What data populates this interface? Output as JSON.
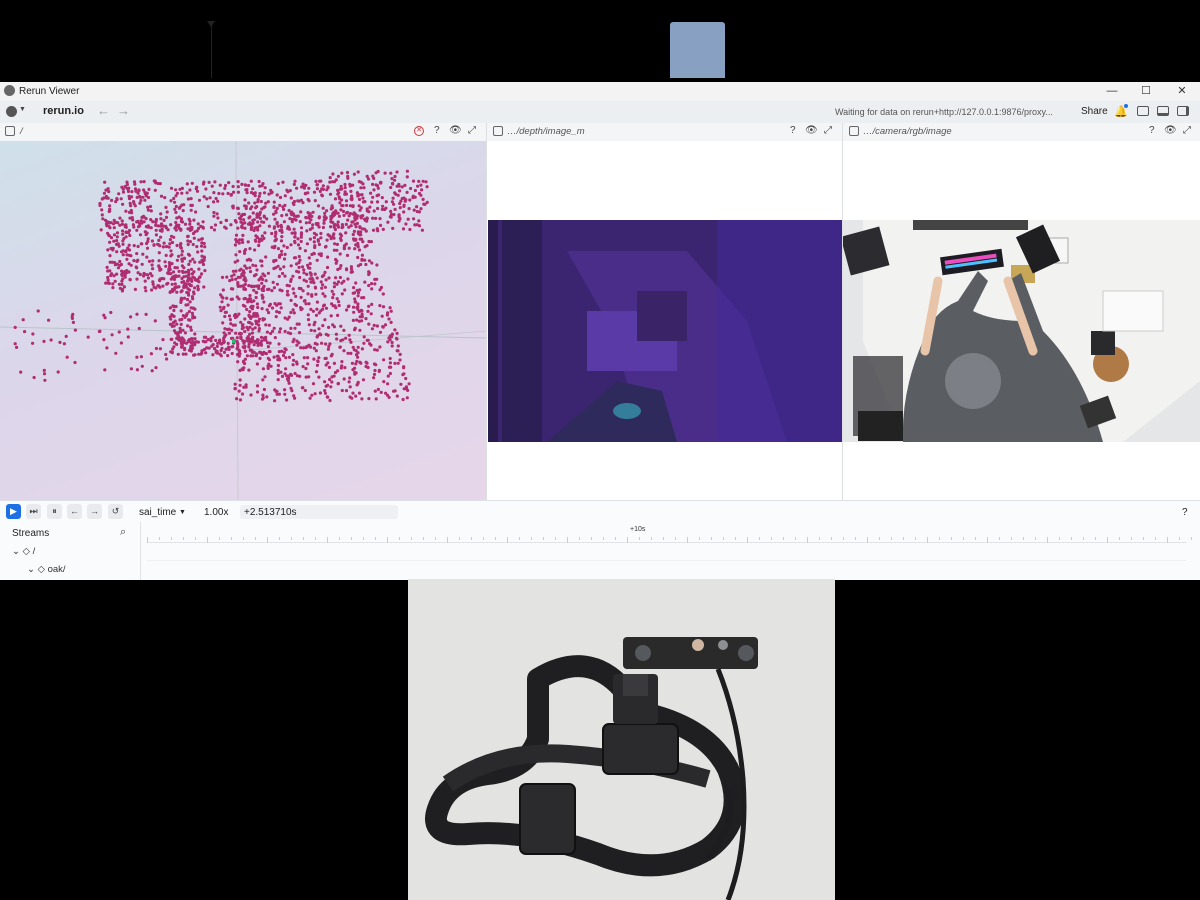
{
  "window": {
    "title": "Rerun Viewer",
    "controls": [
      "—",
      "☐",
      "✕"
    ]
  },
  "topbar": {
    "brand": "rerun.io",
    "back": "←",
    "forward": "→",
    "status": "Waiting for data on rerun+http://127.0.0.1:9876/proxy...",
    "share_label": "Share"
  },
  "panels": {
    "spatial3d": {
      "title": "/",
      "buttons": [
        "?",
        "👁",
        "⤢"
      ]
    },
    "depth": {
      "title": "…/depth/image_m",
      "buttons": [
        "?",
        "👁",
        "⤢"
      ]
    },
    "rgb": {
      "title": "…/camera/rgb/image",
      "buttons": [
        "?",
        "👁",
        "⤢"
      ]
    }
  },
  "timeline": {
    "timeline_name": "sai_time",
    "dropdown_caret": "▼",
    "speed": "1.00x",
    "current_time": "+2.513710s",
    "help": "?",
    "ten_sec_label": "+10s",
    "streams_header": "Streams",
    "stream_root": "/",
    "stream_child": "oak/"
  },
  "colors": {
    "accent": "#1f6fe5",
    "point_cloud": "#b02d72",
    "selection": "#aac8f3",
    "depth_bg": "#3b2570"
  }
}
